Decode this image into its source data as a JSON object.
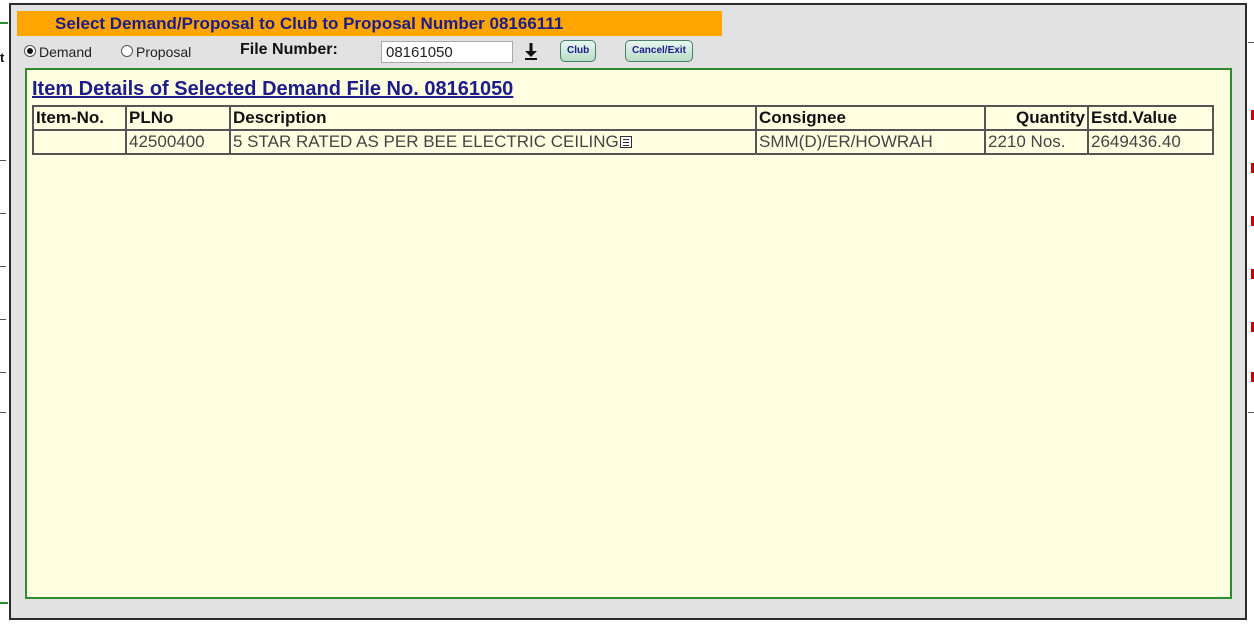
{
  "modal": {
    "title": "Select Demand/Proposal to Club to Proposal Number 08166111"
  },
  "toolbar": {
    "radio_demand_label": "Demand",
    "radio_proposal_label": "Proposal",
    "selected_radio": "Demand",
    "file_number_label": "File Number:",
    "file_number_value": "08161050",
    "club_button": "Club",
    "cancel_button": "Cancel/Exit"
  },
  "panel": {
    "heading": "Item Details of Selected Demand File No. 08161050",
    "columns": [
      "Item-No.",
      "PLNo",
      "Description",
      "Consignee",
      "Quantity",
      "Estd.Value"
    ],
    "rows": [
      {
        "item_no": "",
        "plno": "42500400",
        "description": "5 STAR RATED AS PER BEE ELECTRIC CEILING",
        "consignee": "SMM(D)/ER/HOWRAH",
        "quantity": "2210 Nos.",
        "estd_value": "2649436.40"
      }
    ]
  },
  "background": {
    "left_edge_letter": "t"
  },
  "colors": {
    "title_bg": "#ffa500",
    "title_text": "#1c1c8a",
    "panel_bg": "#ffffe1",
    "panel_border": "#2e8b2e",
    "modal_bg": "#e2e2e2"
  },
  "icons": {
    "download": "download-arrow-icon",
    "description_detail": "description-detail-icon"
  }
}
